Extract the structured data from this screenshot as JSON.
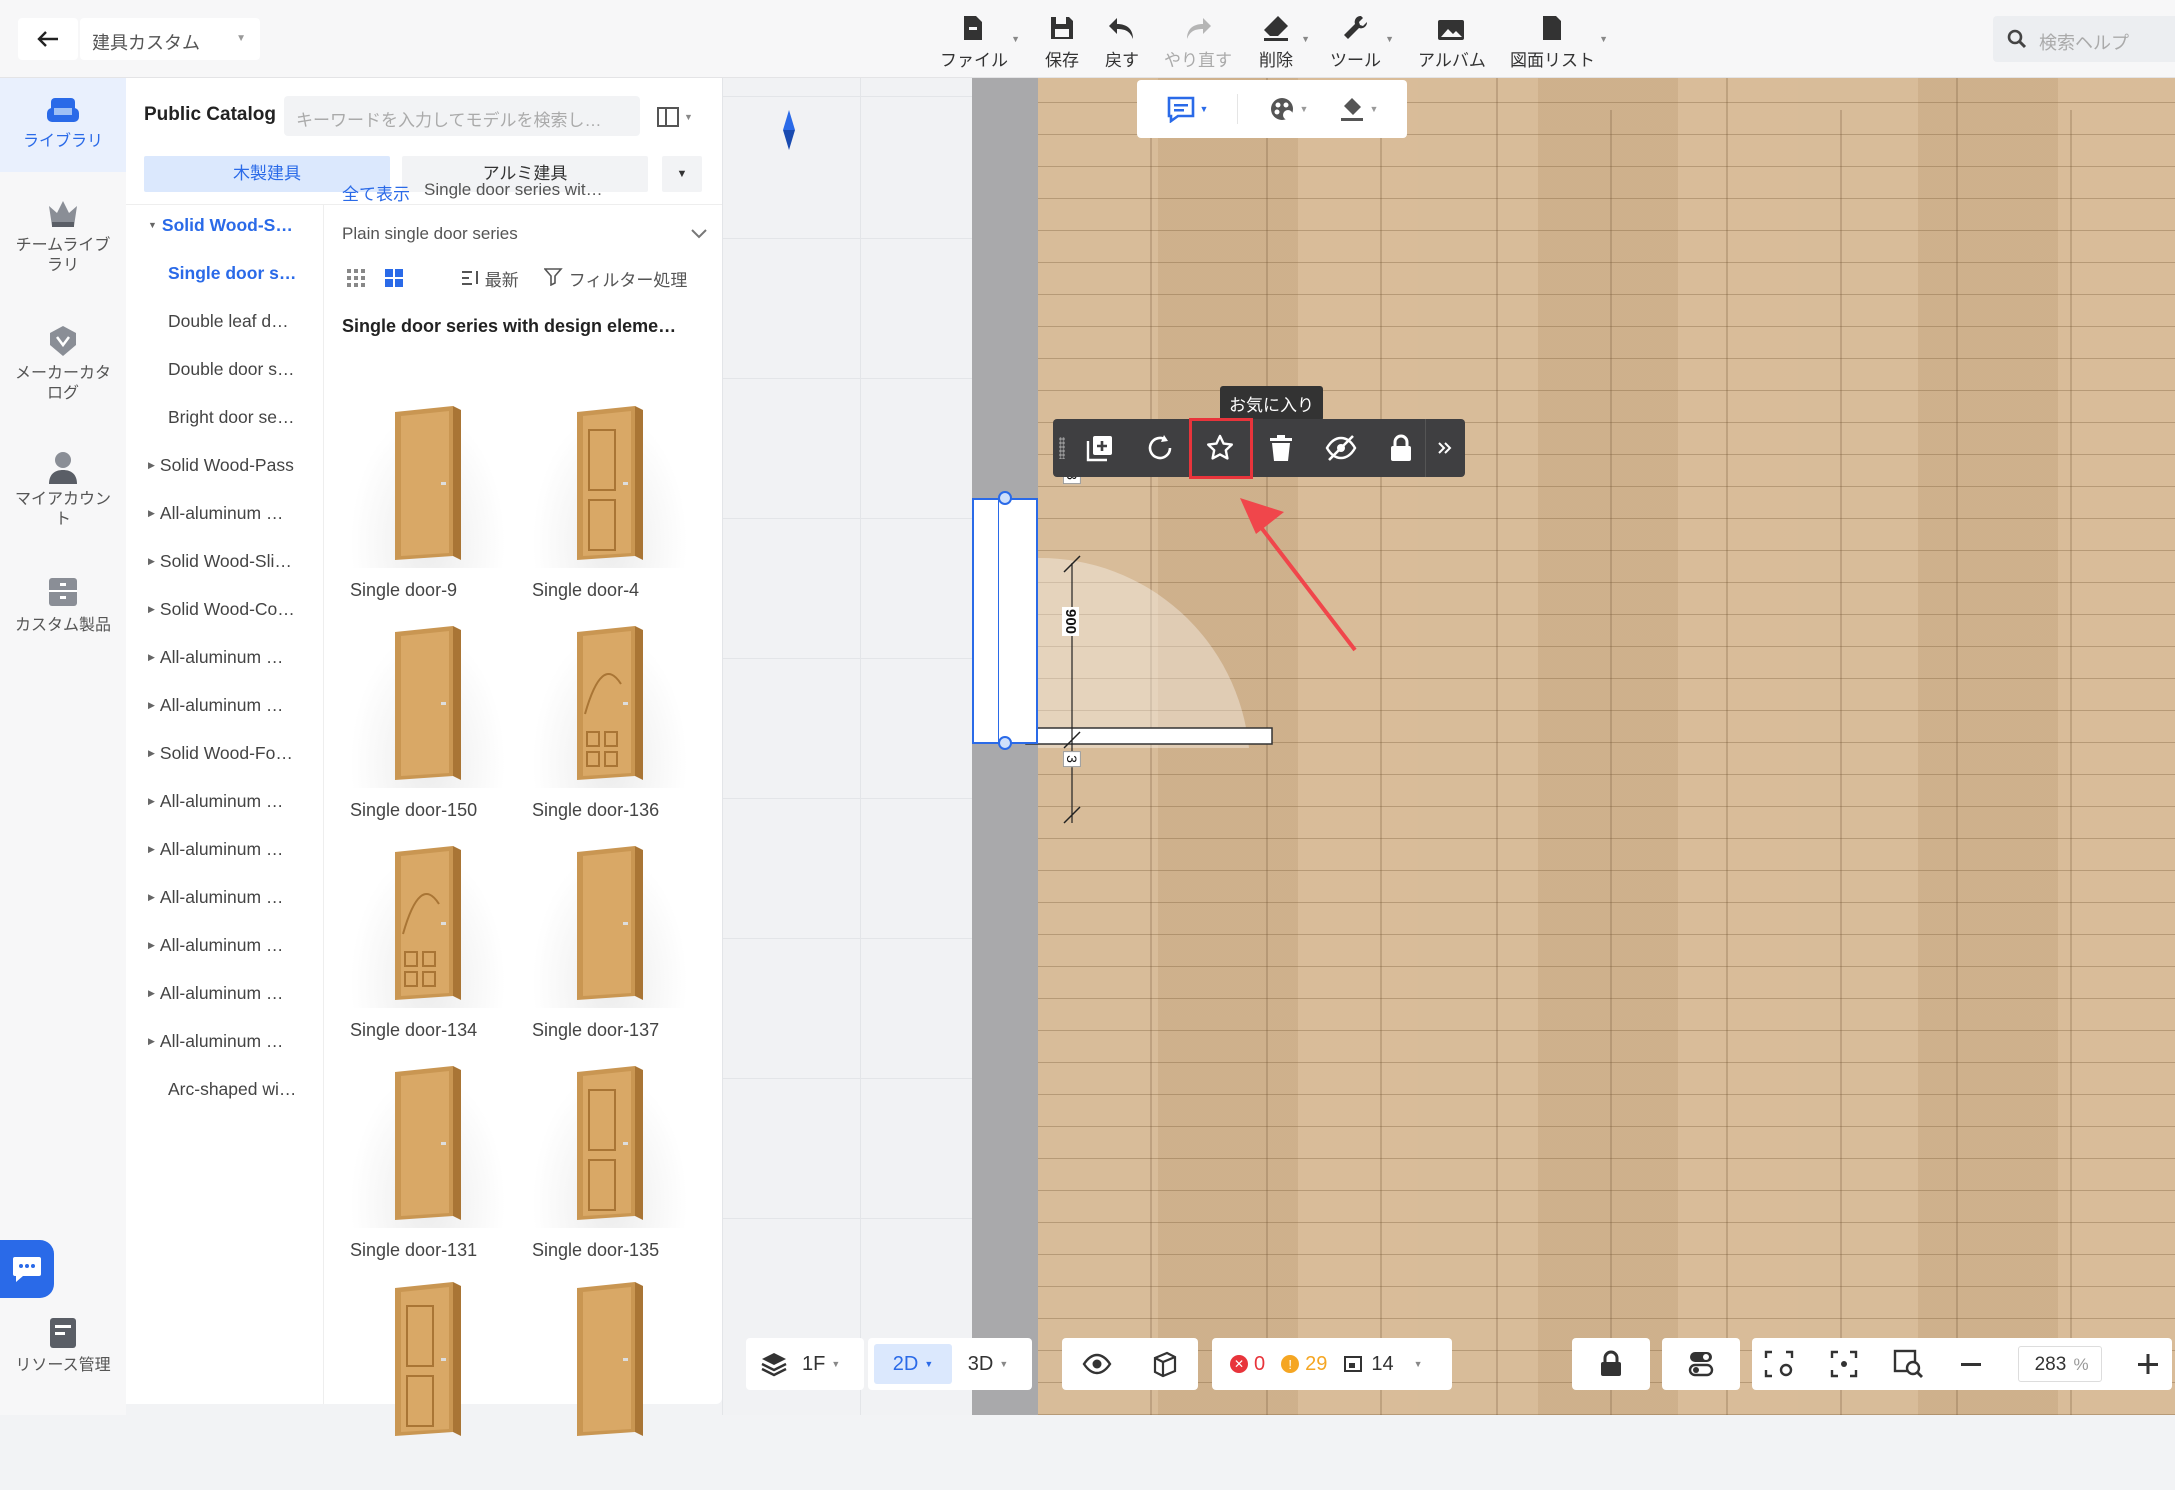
{
  "header": {
    "project_name": "建具カスタム",
    "toolbar": [
      {
        "id": "file",
        "label": "ファイル",
        "has_dropdown": true,
        "icon": "file-icon"
      },
      {
        "id": "save",
        "label": "保存",
        "icon": "save-icon"
      },
      {
        "id": "undo",
        "label": "戻す",
        "icon": "undo-icon"
      },
      {
        "id": "redo",
        "label": "やり直す",
        "icon": "redo-icon",
        "disabled": true
      },
      {
        "id": "delete",
        "label": "削除",
        "has_dropdown": true,
        "icon": "eraser-icon"
      },
      {
        "id": "tools",
        "label": "ツール",
        "has_dropdown": true,
        "icon": "wrench-icon"
      },
      {
        "id": "album",
        "label": "アルバム",
        "icon": "album-icon"
      },
      {
        "id": "drawing_list",
        "label": "図面リスト",
        "has_dropdown": true,
        "icon": "document-icon"
      }
    ],
    "search_placeholder": "検索ヘルプ"
  },
  "leftnav": {
    "items": [
      {
        "id": "library",
        "label": "ライブラリ",
        "active": true,
        "icon": "sofa-icon"
      },
      {
        "id": "team_library",
        "label": "チームライブラリ",
        "icon": "crown-icon"
      },
      {
        "id": "maker_catalog",
        "label": "メーカーカタログ",
        "icon": "badge-icon"
      },
      {
        "id": "my_account",
        "label": "マイアカウント",
        "icon": "user-icon"
      },
      {
        "id": "custom_products",
        "label": "カスタム製品",
        "icon": "cabinet-icon"
      },
      {
        "id": "resources",
        "label": "リソース管理",
        "icon": "resource-icon"
      }
    ]
  },
  "panel": {
    "title": "Public Catalog",
    "search_placeholder": "キーワードを入力してモデルを検索し…",
    "tabs": [
      "木製建具",
      "アルミ建具"
    ],
    "tree": [
      {
        "label": "Solid Wood-S…",
        "expanded": true,
        "level": 0,
        "selected": true
      },
      {
        "label": "Single door s…",
        "level": 1,
        "selected": true
      },
      {
        "label": "Double leaf d…",
        "level": 1
      },
      {
        "label": "Double door s…",
        "level": 1
      },
      {
        "label": "Bright door se…",
        "level": 1
      },
      {
        "label": "Solid Wood-Pass",
        "level": 0
      },
      {
        "label": "All-aluminum …",
        "level": 0
      },
      {
        "label": "Solid Wood-Sli…",
        "level": 0
      },
      {
        "label": "Solid Wood-Co…",
        "level": 0
      },
      {
        "label": "All-aluminum …",
        "level": 0
      },
      {
        "label": "All-aluminum …",
        "level": 0
      },
      {
        "label": "Solid Wood-Fo…",
        "level": 0
      },
      {
        "label": "All-aluminum …",
        "level": 0
      },
      {
        "label": "All-aluminum …",
        "level": 0
      },
      {
        "label": "All-aluminum …",
        "level": 0
      },
      {
        "label": "All-aluminum …",
        "level": 0
      },
      {
        "label": "All-aluminum …",
        "level": 0
      },
      {
        "label": "All-aluminum …",
        "level": 0
      },
      {
        "label": "Arc-shaped wi…",
        "level": 1
      }
    ],
    "breadcrumb_all": "全て表示",
    "breadcrumb_current": "Single door series wit…",
    "series_select": "Plain single door series",
    "sort_label": "最新",
    "filter_label": "フィルター処理",
    "grid_title": "Single door series with design eleme…",
    "models": [
      "Single door-9",
      "Single door-4",
      "Single door-150",
      "Single door-136",
      "Single door-134",
      "Single door-137",
      "Single door-131",
      "Single door-135",
      "",
      ""
    ]
  },
  "canvas": {
    "mini_toolbar": [
      "annotation-icon",
      "color-wheel-icon",
      "paint-icon"
    ],
    "tooltip": "お気に入り",
    "float_toolbar": [
      "copy-icon",
      "rotate-icon",
      "star-icon",
      "trash-icon",
      "hide-icon",
      "lock-icon",
      "more-icon"
    ],
    "dimension_main": "900",
    "dimension_top": "3",
    "dimension_bottom": "3"
  },
  "bottombar": {
    "floor": "1F",
    "mode_2d": "2D",
    "mode_3d": "3D",
    "errors": "0",
    "warnings": "29",
    "rooms": "14",
    "zoom": "283",
    "zoom_unit": "%"
  },
  "colors": {
    "accent": "#2a6ae8",
    "highlight": "#e8343b"
  }
}
